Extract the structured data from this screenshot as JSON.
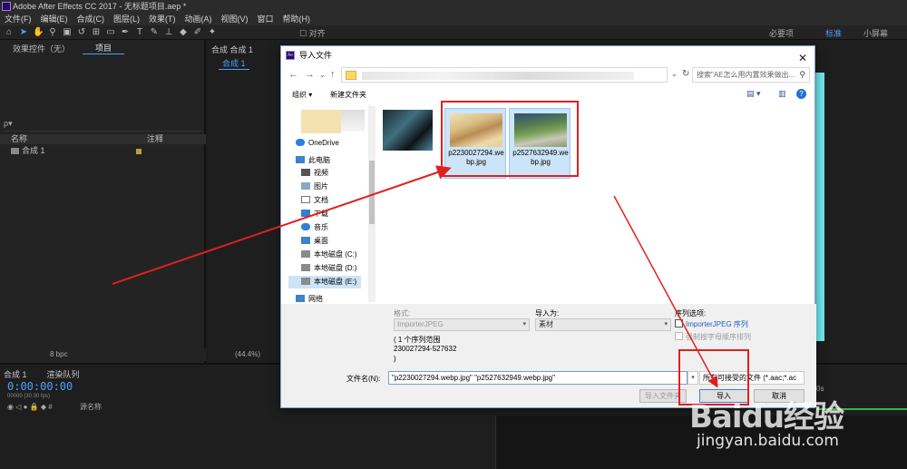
{
  "window": {
    "title": "Adobe After Effects CC 2017 - 无标题项目.aep *"
  },
  "menu": [
    "文件(F)",
    "编辑(E)",
    "合成(C)",
    "图层(L)",
    "效果(T)",
    "动画(A)",
    "视图(V)",
    "窗口",
    "帮助(H)"
  ],
  "toolbar": {
    "snap_label": "对齐",
    "workspace_1": "必要项",
    "workspace_2": "标准",
    "workspace_3": "小屏幕"
  },
  "left_panel": {
    "tab_effects": "效果控件（无）",
    "tab_project": "项目",
    "search_placeholder": "ρ▾",
    "col_name": "名称",
    "col_comment": "注释",
    "row_name": "合成 1",
    "bpc": "8 bpc"
  },
  "comp_panel": {
    "tab": "合成 合成 1",
    "subtab": "合成 1",
    "zoom": "(44.4%)"
  },
  "timeline": {
    "tab_comp": "合成 1",
    "tab_render": "渲染队列",
    "time": "0:00:00:00",
    "fps": "00000 (30.00 fps)",
    "col_source": "源名称",
    "ruler_label": "0s"
  },
  "dialog": {
    "title": "导入文件",
    "search_placeholder": "搜索\"AE怎么用内置效果做出...",
    "organize": "组织 ▾",
    "new_folder": "新建文件夹",
    "nav": {
      "onedrive": "OneDrive",
      "this_pc": "此电脑",
      "videos": "视频",
      "pictures": "图片",
      "documents": "文档",
      "downloads": "下载",
      "music": "音乐",
      "desktop": "桌面",
      "disk_c": "本地磁盘 (C:)",
      "disk_d": "本地磁盘 (D:)",
      "disk_e": "本地磁盘 (E:)",
      "network": "网络"
    },
    "files": [
      {
        "name": "p2230027294.webp.jpg"
      },
      {
        "name": "p2527632949.webp.jpg"
      }
    ],
    "format_label": "格式:",
    "format_value": "ImporterJPEG",
    "import_as_label": "导入为:",
    "import_as_value": "素材",
    "sequence_options_label": "序列选项:",
    "sequence_checkbox": "ImporterJPEG 序列",
    "force_alpha_checkbox": "强制按字母顺序排列",
    "range_line1": "( 1 个序列范围",
    "range_line2": "230027294-527632",
    "range_line3": ")",
    "filename_label": "文件名(N):",
    "filename_value": "\"p2230027294.webp.jpg\" \"p2527632949.webp.jpg\"",
    "filetype_value": "所有可接受的文件 (*.aac;*.ac",
    "import_folder_button": "导入文件夹",
    "import_button": "导入",
    "cancel_button": "取消"
  },
  "watermark": {
    "main": "Baidu经验",
    "url": "jingyan.baidu.com"
  },
  "colors": {
    "ae_bg": "#1d1d1d",
    "accent_blue": "#4aa0ff",
    "annotation_red": "#e02020",
    "selection_blue": "#cce4f7"
  }
}
